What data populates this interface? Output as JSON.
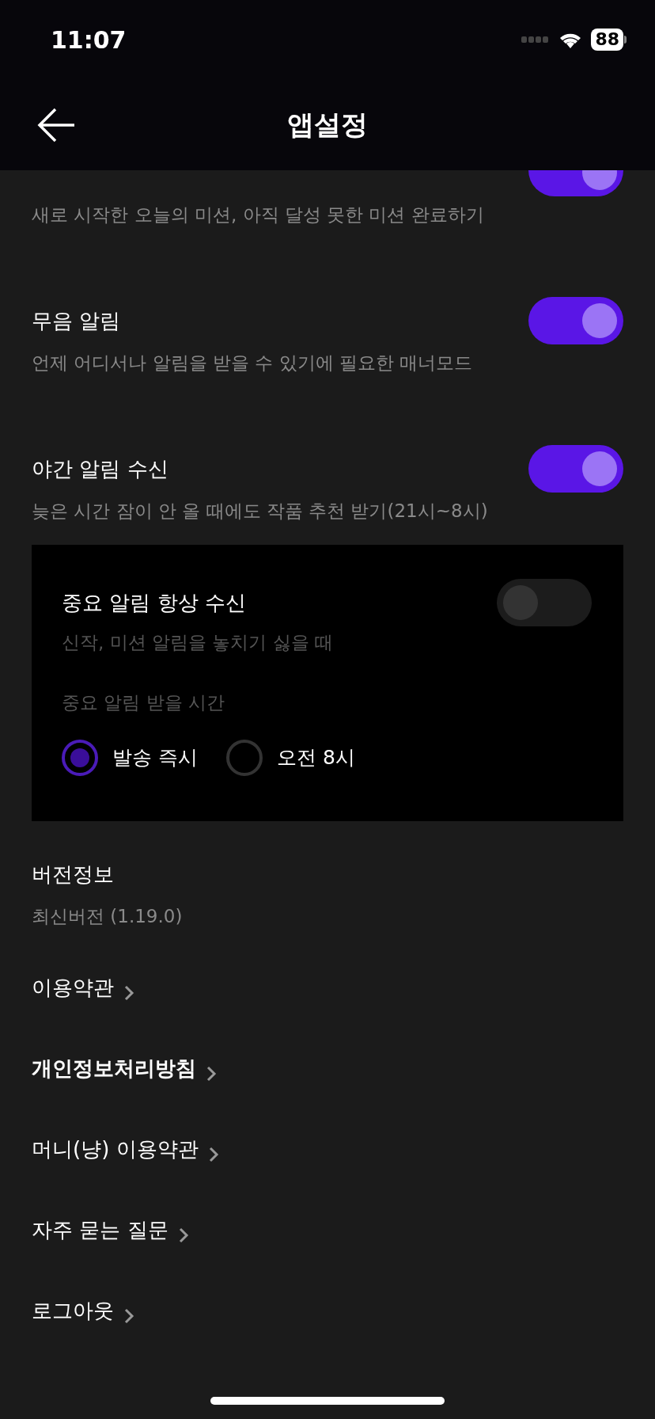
{
  "status_bar": {
    "time": "11:07",
    "battery": "88"
  },
  "header": {
    "title": "앱설정"
  },
  "settings": [
    {
      "description": "새로 시작한 오늘의 미션, 아직 달성 못한 미션 완료하기",
      "on": true
    },
    {
      "title": "무음 알림",
      "description": "언제 어디서나 알림을 받을 수 있기에 필요한 매너모드",
      "on": true
    },
    {
      "title": "야간 알림 수신",
      "description": "늦은 시간 잠이 안 올 때에도 작품 추천 받기(21시~8시)",
      "on": true
    }
  ],
  "important_panel": {
    "title": "중요 알림 항상 수신",
    "description": "신작, 미션 알림을 놓치기 싫을 때",
    "on": false,
    "time_label": "중요 알림 받을 시간",
    "options": [
      {
        "label": "발송 즉시",
        "selected": true
      },
      {
        "label": "오전 8시",
        "selected": false
      }
    ]
  },
  "version": {
    "title": "버전정보",
    "value": "최신버전 (1.19.0)"
  },
  "links": [
    {
      "label": "이용약관",
      "emphasized": false
    },
    {
      "label": "개인정보처리방침",
      "emphasized": true
    },
    {
      "label": "머니(냥) 이용약관",
      "emphasized": false
    },
    {
      "label": "자주 묻는 질문",
      "emphasized": false
    },
    {
      "label": "로그아웃",
      "emphasized": false
    }
  ]
}
